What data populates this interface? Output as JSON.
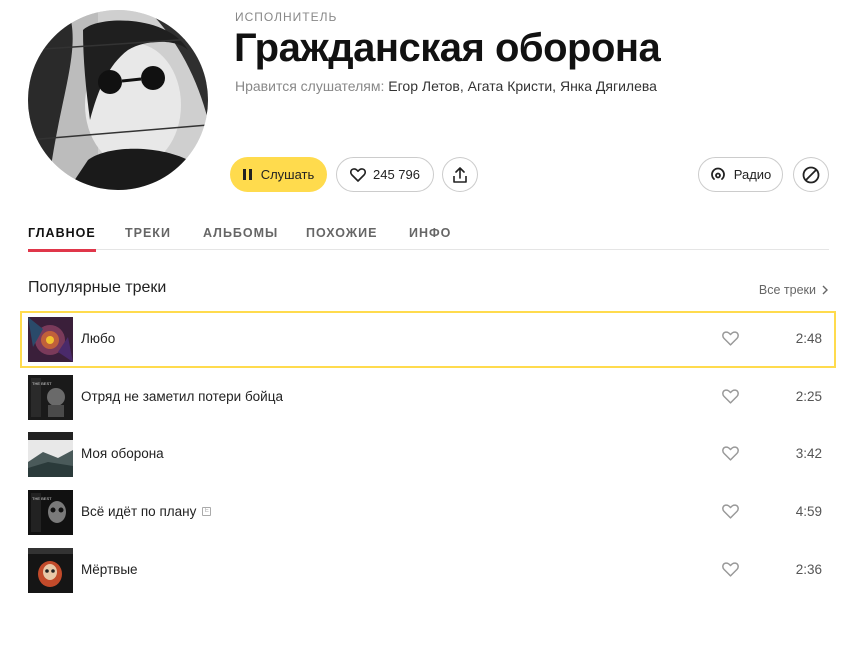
{
  "artist": {
    "type_label": "ИСПОЛНИТЕЛЬ",
    "name": "Гражданская оборона",
    "liked_by_prefix": "Нравится слушателям:",
    "liked_by_artists": "Егор Летов, Агата Кристи, Янка Дягилева"
  },
  "actions": {
    "play_label": "Слушать",
    "likes_count": "245 796",
    "radio_label": "Радио"
  },
  "tabs": [
    {
      "label": "ГЛАВНОЕ",
      "active": true
    },
    {
      "label": "ТРЕКИ",
      "active": false
    },
    {
      "label": "АЛЬБОМЫ",
      "active": false
    },
    {
      "label": "ПОХОЖИЕ",
      "active": false
    },
    {
      "label": "ИНФО",
      "active": false
    }
  ],
  "popular": {
    "title": "Популярные треки",
    "all_label": "Все треки",
    "tracks": [
      {
        "title": "Любо",
        "duration": "2:48",
        "explicit": false,
        "cover_text": ""
      },
      {
        "title": "Отряд не заметил потери бойца",
        "duration": "2:25",
        "explicit": false,
        "cover_text": "THE BEST"
      },
      {
        "title": "Моя оборона",
        "duration": "3:42",
        "explicit": false,
        "cover_text": ""
      },
      {
        "title": "Всё идёт по плану",
        "duration": "4:59",
        "explicit": true,
        "explicit_label": "E",
        "cover_text": "THE BEST"
      },
      {
        "title": "Мёртвые",
        "duration": "2:36",
        "explicit": false,
        "cover_text": ""
      }
    ]
  },
  "colors": {
    "accent_yellow": "#ffdb4d",
    "active_tab_underline": "#e0364a"
  },
  "icons": [
    "pause-icon",
    "heart-icon",
    "share-icon",
    "radio-icon",
    "block-icon",
    "chevron-right-icon"
  ]
}
